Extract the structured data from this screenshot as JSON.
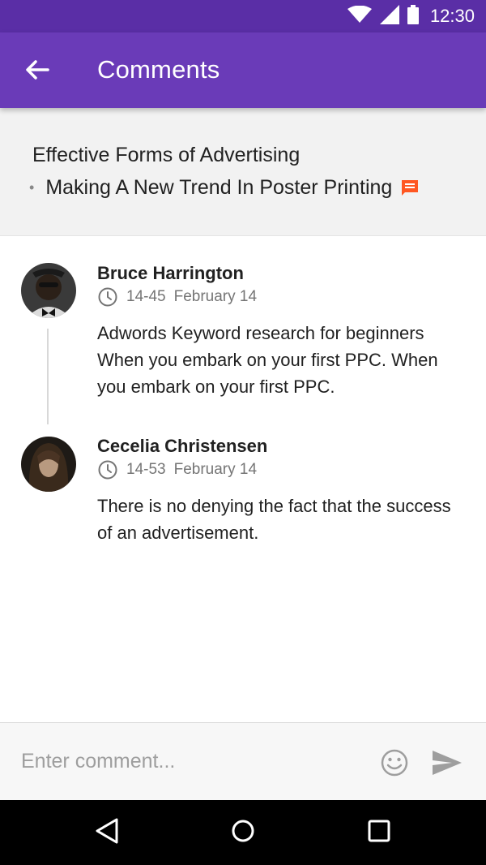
{
  "status_bar": {
    "time": "12:30"
  },
  "app_bar": {
    "title": "Comments"
  },
  "post": {
    "title": "Effective Forms of Advertising",
    "subtitle": "Making A New Trend In Poster Printing"
  },
  "comments": [
    {
      "author": "Bruce Harrington",
      "time": "14-45",
      "date": "February 14",
      "text": "Adwords Keyword research for beginners When you embark on your first PPC. When you embark on your first PPC."
    },
    {
      "author": "Cecelia Christensen",
      "time": "14-53",
      "date": "February 14",
      "text": "There is no denying the fact that the success of an advertisement."
    }
  ],
  "composer": {
    "placeholder": "Enter comment..."
  },
  "colors": {
    "status_bar": "#5a2ea6",
    "app_bar": "#6a3bb8",
    "accent": "#ff5722",
    "header_bg": "#f2f2f2"
  },
  "icons": {
    "status": [
      "wifi-icon",
      "signal-icon",
      "battery-icon"
    ],
    "app_bar": [
      "back-arrow-icon"
    ],
    "post": [
      "comment-icon"
    ],
    "comment_meta": [
      "clock-icon"
    ],
    "composer": [
      "emoji-icon",
      "send-icon"
    ],
    "nav": [
      "back-triangle-icon",
      "home-circle-icon",
      "recents-square-icon"
    ]
  }
}
